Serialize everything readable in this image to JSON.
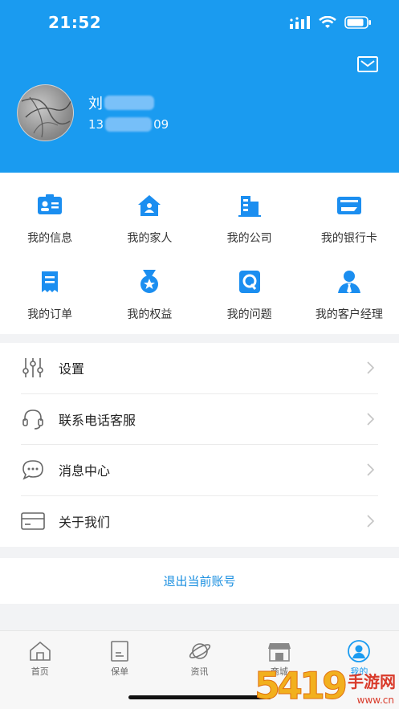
{
  "status_bar": {
    "time": "21:52"
  },
  "profile": {
    "name_prefix": "刘",
    "phone_prefix": "13",
    "phone_suffix": "09"
  },
  "grid": [
    {
      "label": "我的信息",
      "icon": "id-card-icon"
    },
    {
      "label": "我的家人",
      "icon": "house-icon"
    },
    {
      "label": "我的公司",
      "icon": "building-icon"
    },
    {
      "label": "我的银行卡",
      "icon": "bank-card-icon"
    },
    {
      "label": "我的订单",
      "icon": "receipt-icon"
    },
    {
      "label": "我的权益",
      "icon": "medal-icon"
    },
    {
      "label": "我的问题",
      "icon": "question-icon"
    },
    {
      "label": "我的客户经理",
      "icon": "manager-icon"
    }
  ],
  "menu": [
    {
      "label": "设置",
      "icon": "sliders-icon"
    },
    {
      "label": "联系电话客服",
      "icon": "headset-icon"
    },
    {
      "label": "消息中心",
      "icon": "chat-bubble-icon"
    },
    {
      "label": "关于我们",
      "icon": "card-icon"
    }
  ],
  "logout_label": "退出当前账号",
  "tabs": [
    {
      "label": "首页",
      "icon": "home-icon"
    },
    {
      "label": "保单",
      "icon": "policy-icon"
    },
    {
      "label": "资讯",
      "icon": "planet-icon"
    },
    {
      "label": "商城",
      "icon": "shop-icon"
    },
    {
      "label": "我的",
      "icon": "user-icon",
      "active": true
    }
  ],
  "watermark": {
    "number": "5419",
    "text": "手游网",
    "sub": "www.cn"
  },
  "colors": {
    "primary": "#1a9bf0",
    "icon_blue": "#1b8ef0",
    "text": "#222222"
  }
}
